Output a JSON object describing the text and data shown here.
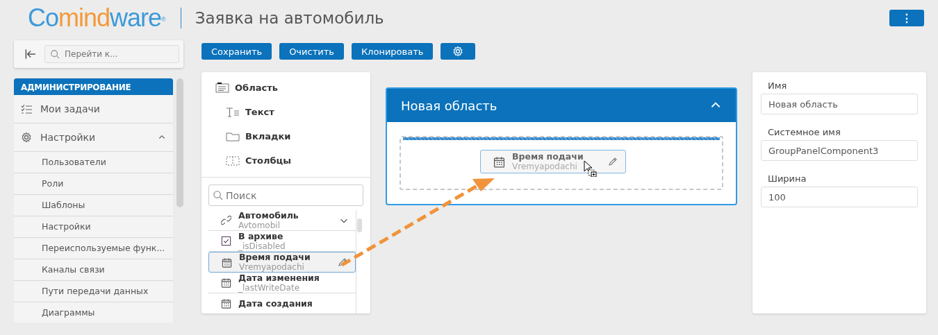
{
  "header": {
    "logo": [
      {
        "text": "Co",
        "color": "#3d9ad9"
      },
      {
        "text": "mind",
        "color": "#f39a3a"
      },
      {
        "text": "ware",
        "color": "#3d9ad9"
      }
    ],
    "logo_mark": "®",
    "title": "Заявка на автомобиль",
    "menu_button": "⋮"
  },
  "sidebar": {
    "search": {
      "placeholder": "Перейти к..."
    },
    "section": "АДМИНИСТРИРОВАНИЕ",
    "items": [
      {
        "label": "Мои задачи",
        "kind": "tasks"
      },
      {
        "label": "Настройки",
        "kind": "gear",
        "expanded": true,
        "children": [
          {
            "label": "Пользователи"
          },
          {
            "label": "Роли"
          },
          {
            "label": "Шаблоны"
          },
          {
            "label": "Настройки"
          },
          {
            "label": "Переиспользуемые функ..."
          },
          {
            "label": "Каналы связи"
          },
          {
            "label": "Пути передачи данных"
          },
          {
            "label": "Диаграммы"
          }
        ]
      }
    ]
  },
  "toolbar": {
    "buttons": [
      {
        "label": "Сохранить",
        "kind": "text"
      },
      {
        "label": "Очистить",
        "kind": "text"
      },
      {
        "label": "Клонировать",
        "kind": "text"
      },
      {
        "kind": "gear"
      }
    ]
  },
  "toolbox": {
    "components": [
      {
        "label": "Область",
        "kind": "area"
      },
      {
        "label": "Текст",
        "kind": "text"
      },
      {
        "label": "Вкладки",
        "kind": "tabs"
      },
      {
        "label": "Столбцы",
        "kind": "columns"
      }
    ],
    "search": {
      "placeholder": "Поиск"
    },
    "attributes": [
      {
        "name": "Автомобиль",
        "system_name": "Avtomobil",
        "kind": "link",
        "selected": false,
        "expandable": true
      },
      {
        "name": "В архиве",
        "system_name": "_isDisabled",
        "kind": "check",
        "selected": false,
        "expandable": false
      },
      {
        "name": "Время подачи",
        "system_name": "Vremyapodachi",
        "kind": "calendar",
        "selected": true,
        "expandable": false
      },
      {
        "name": "Дата изменения",
        "system_name": "_lastWriteDate",
        "kind": "calendar",
        "selected": false,
        "expandable": false
      },
      {
        "name": "Дата создания",
        "kind": "calendar",
        "selected": false,
        "expandable": false
      }
    ]
  },
  "canvas": {
    "panel": {
      "title": "Новая область",
      "expanded": true
    },
    "dragged": {
      "name": "Время подачи",
      "system_name": "Vremyapodachi"
    }
  },
  "properties": {
    "fields": [
      {
        "label": "Имя",
        "value": "Новая область"
      },
      {
        "label": "Системное имя",
        "value": "GroupPanelComponent3"
      },
      {
        "label": "Ширина",
        "value": "100"
      }
    ]
  }
}
